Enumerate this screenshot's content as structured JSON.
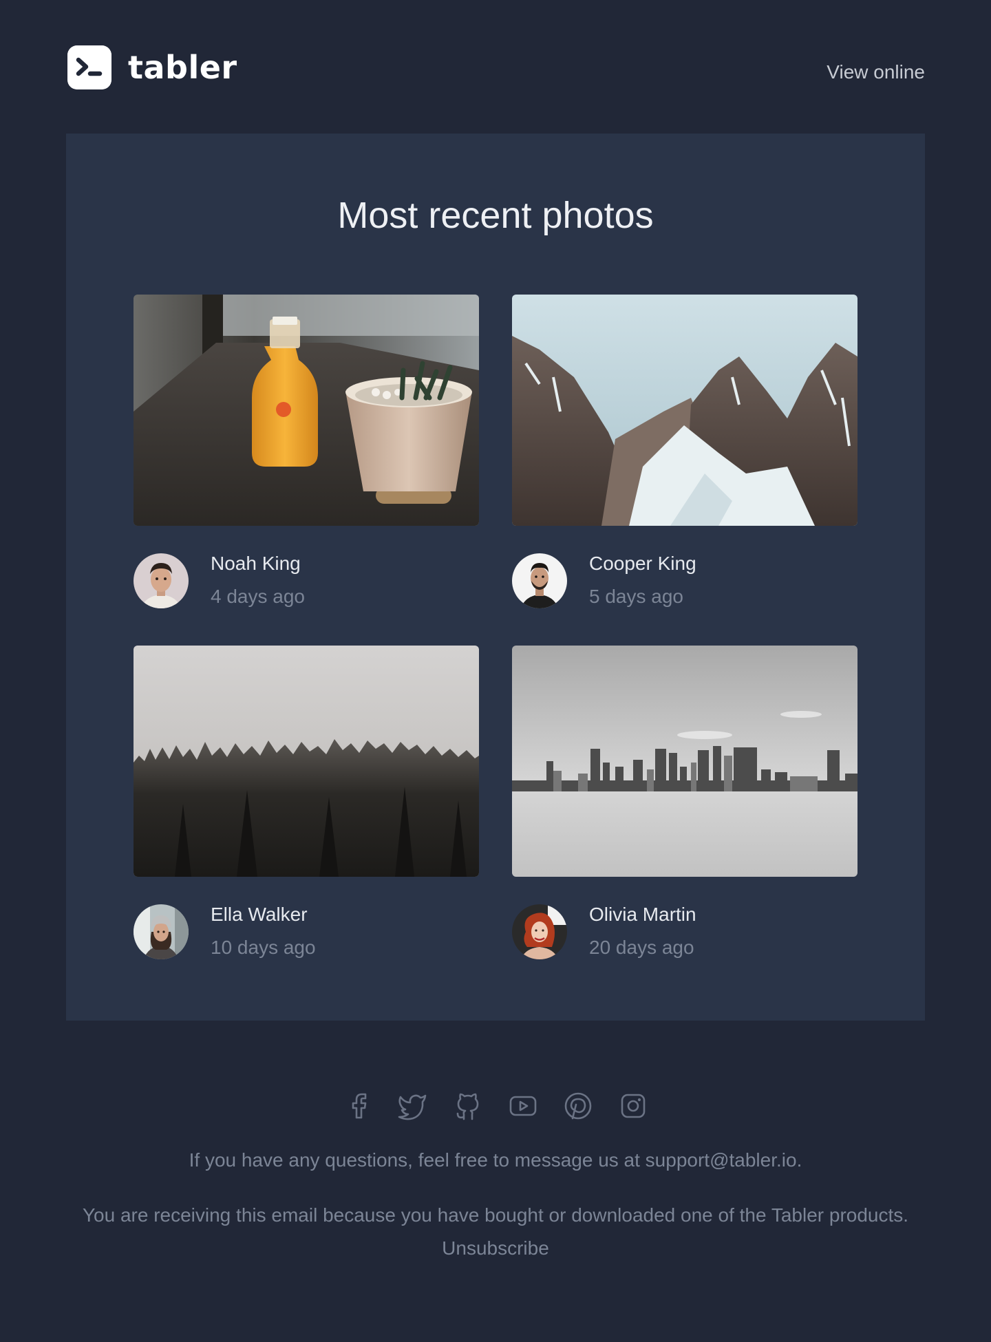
{
  "header": {
    "brand_name": "tabler",
    "logo_icon": "terminal-prompt-icon",
    "view_online_label": "View online"
  },
  "main": {
    "title": "Most recent photos",
    "photos": [
      {
        "subject": "orange juice bottle and cactus pot on windowsill",
        "author": "Noah King",
        "time": "4 days ago"
      },
      {
        "subject": "snowy rocky mountain peaks",
        "author": "Cooper King",
        "time": "5 days ago"
      },
      {
        "subject": "foggy pine forest",
        "author": "Ella Walker",
        "time": "10 days ago"
      },
      {
        "subject": "city skyline over water in black and white",
        "author": "Olivia Martin",
        "time": "20 days ago"
      }
    ]
  },
  "footer": {
    "social_icons": [
      "facebook-icon",
      "twitter-icon",
      "github-icon",
      "youtube-icon",
      "pinterest-icon",
      "instagram-icon"
    ],
    "questions_text": "If you have any questions, feel free to message us at support@tabler.io.",
    "receiving_text": "You are receiving this email because you have bought or downloaded one of the Tabler products.",
    "unsubscribe_label": "Unsubscribe"
  },
  "colors": {
    "page_background": "#212737",
    "card_background": "#2a3448",
    "muted_text": "#7c8596"
  }
}
